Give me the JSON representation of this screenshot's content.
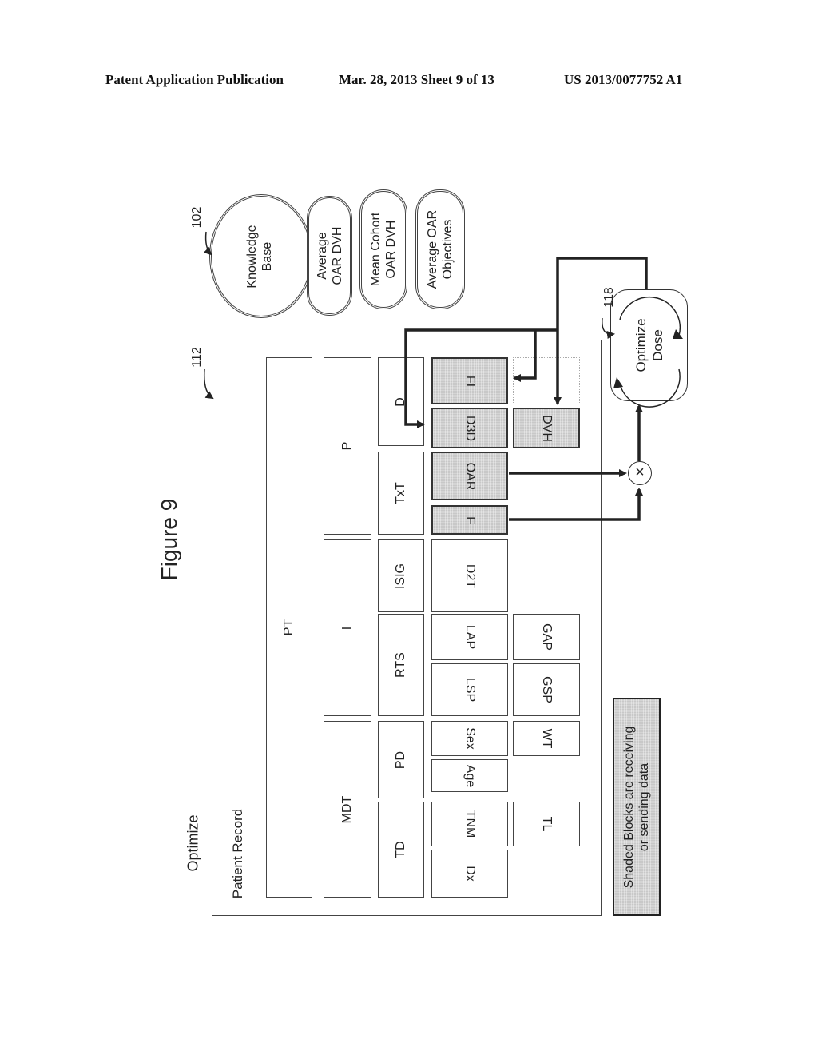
{
  "header": {
    "publication": "Patent Application Publication",
    "date_sheet": "Mar. 28, 2013  Sheet 9 of 13",
    "number": "US 2013/0077752 A1"
  },
  "figure": {
    "title": "Figure 9",
    "section_label": "Optimize",
    "record_label": "Patient Record",
    "ref_record": "112",
    "ref_knowledge": "102",
    "ref_optimize": "118"
  },
  "knowledge_base": {
    "label_line1": "Knowledge",
    "label_line2": "Base",
    "items": [
      {
        "line1": "Average",
        "line2": "OAR DVH"
      },
      {
        "line1": "Mean Cohort",
        "line2": "OAR DVH"
      },
      {
        "line1": "Average OAR",
        "line2": "Objectives"
      }
    ]
  },
  "optimize_dose": {
    "line1": "Optimize",
    "line2": "Dose"
  },
  "multiply_symbol": "×",
  "blocks": {
    "PT": "PT",
    "P": "P",
    "I": "I",
    "MDT": "MDT",
    "D": "D",
    "TxT": "TxT",
    "ISIG": "ISIG",
    "RTS": "RTS",
    "PD": "PD",
    "TD": "TD",
    "FI": "FI",
    "D3D": "D3D",
    "OAR": "OAR",
    "F": "F",
    "D2T": "D2T",
    "LAP": "LAP",
    "LSP": "LSP",
    "Sex": "Sex",
    "Age": "Age",
    "TNM": "TNM",
    "Dx": "Dx",
    "DVH": "DVH",
    "GAP": "GAP",
    "GSP": "GSP",
    "WT": "WT",
    "TL": "TL"
  },
  "shaded_blocks": [
    "FI",
    "D3D",
    "OAR",
    "F",
    "DVH"
  ],
  "legend": {
    "line1": "Shaded Blocks are receiving",
    "line2": "or sending data"
  }
}
